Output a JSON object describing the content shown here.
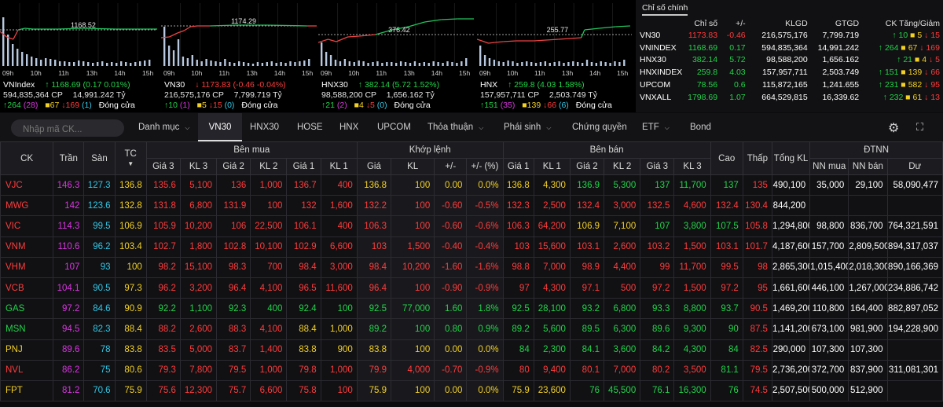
{
  "index_charts": [
    {
      "name": "VNIndex",
      "ref_label": "1168.52",
      "times": [
        "09h",
        "10h",
        "11h",
        "13h",
        "14h",
        "15h"
      ],
      "value": "1168.69",
      "change": "(0.17",
      "change_pct": "0.01%)",
      "dir": "up",
      "arrow": "↑",
      "volume": "594,835,364 CP",
      "value_traded": "14,991.242 Tỷ",
      "breadth": {
        "up": "264",
        "ceil": "(28)",
        "ref": "67",
        "down": "169",
        "floor": "(1)",
        "status": "Đóng cửa"
      }
    },
    {
      "name": "VN30",
      "ref_label": "1174.29",
      "times": [
        "09h",
        "10h",
        "11h",
        "13h",
        "14h",
        "15h"
      ],
      "value": "1173.83",
      "change": "(-0.46",
      "change_pct": "-0.04%)",
      "dir": "dn",
      "arrow": "↓",
      "volume": "216,575,176 CP",
      "value_traded": "7,799.719 Tỷ",
      "breadth": {
        "up": "10",
        "ceil": "(1)",
        "ref": "5",
        "down": "15",
        "floor": "(0)",
        "status": "Đóng cửa"
      }
    },
    {
      "name": "HNX30",
      "ref_label": "376.42",
      "times": [
        "09h",
        "10h",
        "11h",
        "13h",
        "14h",
        "15h"
      ],
      "value": "382.14",
      "change": "(5.72",
      "change_pct": "1.52%)",
      "dir": "up",
      "arrow": "↑",
      "volume": "98,588,200 CP",
      "value_traded": "1,656.162 Tỷ",
      "breadth": {
        "up": "21",
        "ceil": "(2)",
        "ref": "4",
        "down": "5",
        "floor": "(0)",
        "status": "Đóng cửa"
      }
    },
    {
      "name": "HNX",
      "ref_label": "255.77",
      "times": [
        "09h",
        "10h",
        "11h",
        "13h",
        "14h",
        "15h"
      ],
      "value": "259.8",
      "change": "(4.03",
      "change_pct": "1.58%)",
      "dir": "up",
      "arrow": "↑",
      "volume": "157,957,711 CP",
      "value_traded": "2,503.749 Tỷ",
      "breadth": {
        "up": "151",
        "ceil": "(35)",
        "ref": "139",
        "down": "66",
        "floor": "(6)",
        "status": "Đóng cửa"
      }
    }
  ],
  "index_panel": {
    "tab_label": "Chỉ số chính",
    "headers": [
      "",
      "Chỉ số",
      "+/-",
      "KLGD",
      "GTGD",
      "CK Tăng/Giảm"
    ],
    "rows": [
      {
        "name": "VN30",
        "value": "1173.83",
        "chg": "-0.46",
        "vol": "216,575,176",
        "val": "7,799.719",
        "up": "10",
        "ref": "5",
        "down": "15",
        "dir": "dn"
      },
      {
        "name": "VNINDEX",
        "value": "1168.69",
        "chg": "0.17",
        "vol": "594,835,364",
        "val": "14,991.242",
        "up": "264",
        "ref": "67",
        "down": "169",
        "dir": "up"
      },
      {
        "name": "HNX30",
        "value": "382.14",
        "chg": "5.72",
        "vol": "98,588,200",
        "val": "1,656.162",
        "up": "21",
        "ref": "4",
        "down": "5",
        "dir": "up"
      },
      {
        "name": "HNXINDEX",
        "value": "259.8",
        "chg": "4.03",
        "vol": "157,957,711",
        "val": "2,503.749",
        "up": "151",
        "ref": "139",
        "down": "66",
        "dir": "up"
      },
      {
        "name": "UPCOM",
        "value": "78.56",
        "chg": "0.6",
        "vol": "115,872,165",
        "val": "1,241.655",
        "up": "231",
        "ref": "582",
        "down": "95",
        "dir": "up"
      },
      {
        "name": "VNXALL",
        "value": "1798.69",
        "chg": "1.07",
        "vol": "664,529,815",
        "val": "16,339.62",
        "up": "232",
        "ref": "61",
        "down": "13",
        "dir": "up"
      }
    ]
  },
  "nav": {
    "search_placeholder": "Nhập mã CK...",
    "tabs": [
      {
        "label": "Danh mục",
        "chevron": true,
        "active": false
      },
      {
        "label": "VN30",
        "chevron": false,
        "active": true
      },
      {
        "label": "HNX30",
        "chevron": false,
        "active": false
      },
      {
        "label": "HOSE",
        "chevron": false,
        "active": false
      },
      {
        "label": "HNX",
        "chevron": false,
        "active": false
      },
      {
        "label": "UPCOM",
        "chevron": false,
        "active": false
      },
      {
        "label": "Thỏa thuận",
        "chevron": true,
        "active": false
      },
      {
        "label": "Phái sinh",
        "chevron": true,
        "active": false
      },
      {
        "label": "Chứng quyền",
        "chevron": false,
        "active": false
      },
      {
        "label": "ETF",
        "chevron": true,
        "active": false
      },
      {
        "label": "Bond",
        "chevron": false,
        "active": false
      }
    ],
    "gear_icon": "gear-icon",
    "expand_icon": "expand-icon"
  },
  "table": {
    "headers": {
      "ck": "CK",
      "tran": "Trần",
      "san": "Sàn",
      "tc": "TC",
      "ben_mua": "Bên mua",
      "khop": "Khớp lệnh",
      "ben_ban": "Bên bán",
      "cao": "Cao",
      "thap": "Thấp",
      "tong_kl": "Tổng KL",
      "dtnn": "ĐTNN"
    },
    "subheaders": [
      "Giá 3",
      "KL 3",
      "Giá 2",
      "KL 2",
      "Giá 1",
      "KL 1",
      "Giá",
      "KL",
      "+/-",
      "+/- (%)",
      "Giá 1",
      "KL 1",
      "Giá 2",
      "KL 2",
      "Giá 3",
      "KL 3",
      "NN mua",
      "NN bán",
      "Dư"
    ],
    "sort_icon": "▼",
    "rows": [
      {
        "s": "VJC",
        "d": "dn",
        "c": [
          "146.3",
          "127.3",
          "136.8",
          "135.6",
          "5,100",
          "136",
          "1,000",
          "136.7",
          "400",
          "136.8",
          "100",
          "0.00",
          "0.0%",
          "136.8",
          "4,300",
          "136.9",
          "5,300",
          "137",
          "11,700",
          "137",
          "135",
          "490,100",
          "35,000",
          "29,100",
          "58,090,477"
        ],
        "k": [
          "ceil",
          "floor",
          "ref",
          "dn",
          "dn",
          "dn",
          "dn",
          "dn",
          "dn",
          "ref",
          "ref",
          "ref",
          "ref",
          "ref",
          "ref",
          "up",
          "up",
          "up",
          "up",
          "up",
          "dn",
          "wht",
          "wht",
          "wht",
          "wht"
        ]
      },
      {
        "s": "MWG",
        "d": "dn",
        "c": [
          "142",
          "123.6",
          "132.8",
          "131.8",
          "6,800",
          "131.9",
          "100",
          "132",
          "1,600",
          "132.2",
          "100",
          "-0.60",
          "-0.5%",
          "132.3",
          "2,500",
          "132.4",
          "3,000",
          "132.5",
          "4,600",
          "132.4",
          "130.4",
          "844,200",
          "",
          "",
          ""
        ],
        "k": [
          "ceil",
          "floor",
          "ref",
          "dn",
          "dn",
          "dn",
          "dn",
          "dn",
          "dn",
          "dn",
          "dn",
          "dn",
          "dn",
          "dn",
          "dn",
          "dn",
          "dn",
          "dn",
          "dn",
          "dn",
          "dn",
          "wht",
          "wht",
          "wht",
          "wht"
        ]
      },
      {
        "s": "VIC",
        "d": "dn",
        "c": [
          "114.3",
          "99.5",
          "106.9",
          "105.9",
          "10,200",
          "106",
          "22,500",
          "106.1",
          "400",
          "106.3",
          "100",
          "-0.60",
          "-0.6%",
          "106.3",
          "64,200",
          "106.9",
          "7,100",
          "107",
          "3,800",
          "107.5",
          "105.8",
          "1,294,800",
          "98,800",
          "836,700",
          "764,321,591"
        ],
        "k": [
          "ceil",
          "floor",
          "ref",
          "dn",
          "dn",
          "dn",
          "dn",
          "dn",
          "dn",
          "dn",
          "dn",
          "dn",
          "dn",
          "dn",
          "dn",
          "ref",
          "ref",
          "up",
          "up",
          "up",
          "dn",
          "wht",
          "wht",
          "wht",
          "wht"
        ]
      },
      {
        "s": "VNM",
        "d": "dn",
        "c": [
          "110.6",
          "96.2",
          "103.4",
          "102.7",
          "1,800",
          "102.8",
          "10,100",
          "102.9",
          "6,600",
          "103",
          "1,500",
          "-0.40",
          "-0.4%",
          "103",
          "15,600",
          "103.1",
          "2,600",
          "103.2",
          "1,500",
          "103.1",
          "101.7",
          "4,187,600",
          "157,700",
          "2,809,500",
          "894,317,037"
        ],
        "k": [
          "ceil",
          "floor",
          "ref",
          "dn",
          "dn",
          "dn",
          "dn",
          "dn",
          "dn",
          "dn",
          "dn",
          "dn",
          "dn",
          "dn",
          "dn",
          "dn",
          "dn",
          "dn",
          "dn",
          "dn",
          "dn",
          "wht",
          "wht",
          "wht",
          "wht"
        ]
      },
      {
        "s": "VHM",
        "d": "dn",
        "c": [
          "107",
          "93",
          "100",
          "98.2",
          "15,100",
          "98.3",
          "700",
          "98.4",
          "3,000",
          "98.4",
          "10,200",
          "-1.60",
          "-1.6%",
          "98.8",
          "7,000",
          "98.9",
          "4,400",
          "99",
          "11,700",
          "99.5",
          "98",
          "2,865,300",
          "1,015,400",
          "2,018,300",
          "890,166,369"
        ],
        "k": [
          "ceil",
          "floor",
          "ref",
          "dn",
          "dn",
          "dn",
          "dn",
          "dn",
          "dn",
          "dn",
          "dn",
          "dn",
          "dn",
          "dn",
          "dn",
          "dn",
          "dn",
          "dn",
          "dn",
          "dn",
          "dn",
          "wht",
          "wht",
          "wht",
          "wht"
        ]
      },
      {
        "s": "VCB",
        "d": "dn",
        "c": [
          "104.1",
          "90.5",
          "97.3",
          "96.2",
          "3,200",
          "96.4",
          "4,100",
          "96.5",
          "11,600",
          "96.4",
          "100",
          "-0.90",
          "-0.9%",
          "97",
          "4,300",
          "97.1",
          "500",
          "97.2",
          "1,500",
          "97.2",
          "95",
          "1,661,600",
          "446,100",
          "1,267,000",
          "234,886,742"
        ],
        "k": [
          "ceil",
          "floor",
          "ref",
          "dn",
          "dn",
          "dn",
          "dn",
          "dn",
          "dn",
          "dn",
          "dn",
          "dn",
          "dn",
          "dn",
          "dn",
          "dn",
          "dn",
          "dn",
          "dn",
          "dn",
          "dn",
          "wht",
          "wht",
          "wht",
          "wht"
        ]
      },
      {
        "s": "GAS",
        "d": "up",
        "c": [
          "97.2",
          "84.6",
          "90.9",
          "92.2",
          "1,100",
          "92.3",
          "400",
          "92.4",
          "100",
          "92.5",
          "77,000",
          "1.60",
          "1.8%",
          "92.5",
          "28,100",
          "93.2",
          "6,800",
          "93.3",
          "8,800",
          "93.7",
          "90.5",
          "1,469,200",
          "110,800",
          "164,400",
          "882,897,052"
        ],
        "k": [
          "ceil",
          "floor",
          "ref",
          "up",
          "up",
          "up",
          "up",
          "up",
          "up",
          "up",
          "up",
          "up",
          "up",
          "up",
          "up",
          "up",
          "up",
          "up",
          "up",
          "up",
          "dn",
          "wht",
          "wht",
          "wht",
          "wht"
        ]
      },
      {
        "s": "MSN",
        "d": "up",
        "c": [
          "94.5",
          "82.3",
          "88.4",
          "88.2",
          "2,600",
          "88.3",
          "4,100",
          "88.4",
          "1,000",
          "89.2",
          "100",
          "0.80",
          "0.9%",
          "89.2",
          "5,600",
          "89.5",
          "6,300",
          "89.6",
          "9,300",
          "90",
          "87.5",
          "1,141,200",
          "673,100",
          "981,900",
          "194,228,900"
        ],
        "k": [
          "ceil",
          "floor",
          "ref",
          "dn",
          "dn",
          "dn",
          "dn",
          "ref",
          "ref",
          "up",
          "up",
          "up",
          "up",
          "up",
          "up",
          "up",
          "up",
          "up",
          "up",
          "up",
          "dn",
          "wht",
          "wht",
          "wht",
          "wht"
        ]
      },
      {
        "s": "PNJ",
        "d": "ref",
        "c": [
          "89.6",
          "78",
          "83.8",
          "83.5",
          "5,000",
          "83.7",
          "1,400",
          "83.8",
          "900",
          "83.8",
          "100",
          "0.00",
          "0.0%",
          "84",
          "2,300",
          "84.1",
          "3,600",
          "84.2",
          "4,300",
          "84",
          "82.5",
          "290,000",
          "107,300",
          "107,300",
          ""
        ],
        "k": [
          "ceil",
          "floor",
          "ref",
          "dn",
          "dn",
          "dn",
          "dn",
          "ref",
          "ref",
          "ref",
          "ref",
          "ref",
          "ref",
          "up",
          "up",
          "up",
          "up",
          "up",
          "up",
          "up",
          "dn",
          "wht",
          "wht",
          "wht",
          "wht"
        ]
      },
      {
        "s": "NVL",
        "d": "dn",
        "c": [
          "86.2",
          "75",
          "80.6",
          "79.3",
          "7,800",
          "79.5",
          "1,000",
          "79.8",
          "1,000",
          "79.9",
          "4,000",
          "-0.70",
          "-0.9%",
          "80",
          "9,400",
          "80.1",
          "7,000",
          "80.2",
          "3,500",
          "81.1",
          "79.5",
          "2,736,200",
          "372,700",
          "837,900",
          "311,081,301"
        ],
        "k": [
          "ceil",
          "floor",
          "ref",
          "dn",
          "dn",
          "dn",
          "dn",
          "dn",
          "dn",
          "dn",
          "dn",
          "dn",
          "dn",
          "dn",
          "dn",
          "dn",
          "dn",
          "dn",
          "dn",
          "up",
          "dn",
          "wht",
          "wht",
          "wht",
          "wht"
        ]
      },
      {
        "s": "FPT",
        "d": "ref",
        "c": [
          "81.2",
          "70.6",
          "75.9",
          "75.6",
          "12,300",
          "75.7",
          "6,600",
          "75.8",
          "100",
          "75.9",
          "100",
          "0.00",
          "0.0%",
          "75.9",
          "23,600",
          "76",
          "45,500",
          "76.1",
          "16,300",
          "76",
          "74.5",
          "2,507,500",
          "500,000",
          "512,900",
          ""
        ],
        "k": [
          "ceil",
          "floor",
          "ref",
          "dn",
          "dn",
          "dn",
          "dn",
          "dn",
          "dn",
          "ref",
          "ref",
          "ref",
          "ref",
          "ref",
          "ref",
          "up",
          "up",
          "up",
          "up",
          "up",
          "dn",
          "wht",
          "wht",
          "wht",
          "wht"
        ]
      }
    ]
  }
}
